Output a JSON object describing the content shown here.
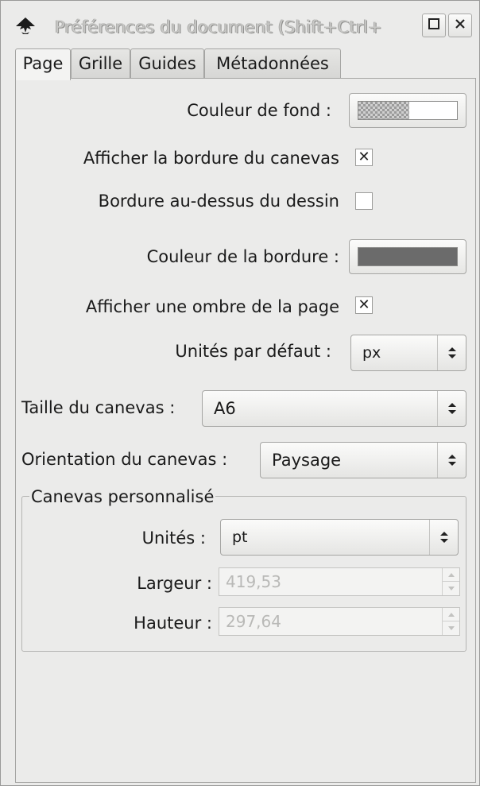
{
  "window": {
    "title": "Préférences du document (Shift+Ctrl+",
    "icon": "inkscape-logo-icon"
  },
  "tabs": [
    {
      "label": "Page",
      "active": true
    },
    {
      "label": "Grille",
      "active": false
    },
    {
      "label": "Guides",
      "active": false
    },
    {
      "label": "Métadonnées",
      "active": false
    }
  ],
  "page": {
    "background_color_label": "Couleur de fond :",
    "show_canvas_border_label": "Afficher la bordure du canevas",
    "show_canvas_border_checked": true,
    "border_on_top_label": "Bordure au-dessus du dessin",
    "border_on_top_checked": false,
    "border_color_label": "Couleur de la bordure :",
    "border_color": "#6b6b6b",
    "show_page_shadow_label": "Afficher une ombre de la page",
    "show_page_shadow_checked": true,
    "default_units_label": "Unités par défaut :",
    "default_units_value": "px",
    "canvas_size_label": "Taille du canevas :",
    "canvas_size_value": "A6",
    "canvas_orientation_label": "Orientation du canevas :",
    "canvas_orientation_value": "Paysage",
    "custom_canvas": {
      "title": "Canevas personnalisé",
      "units_label": "Unités :",
      "units_value": "pt",
      "width_label": "Largeur :",
      "width_value": "419,53",
      "height_label": "Hauteur :",
      "height_value": "297,64"
    }
  },
  "checkmark_glyph": "✕"
}
